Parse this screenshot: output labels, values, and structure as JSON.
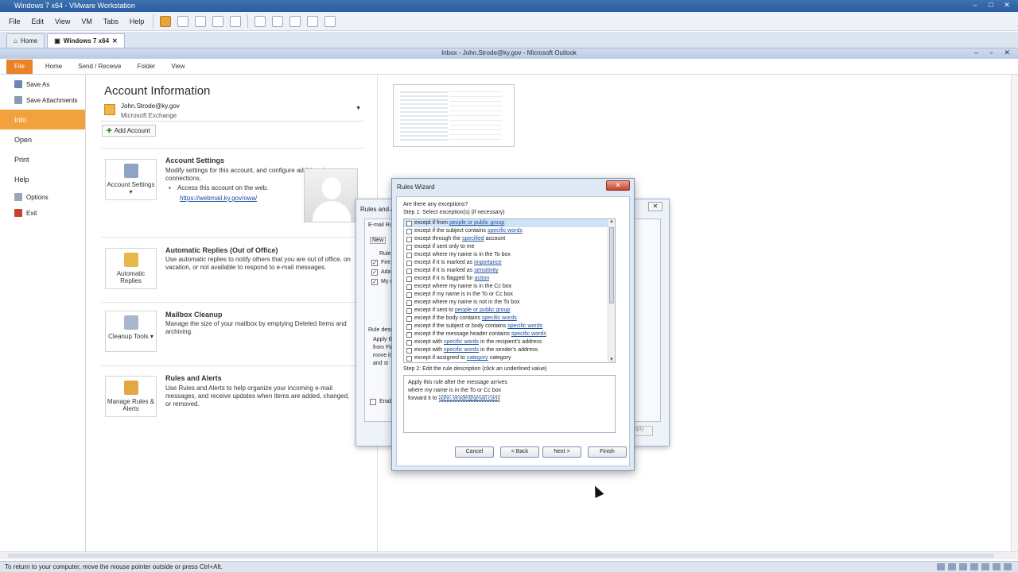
{
  "vm": {
    "title": "Windows 7 x64 - VMware Workstation",
    "menu": [
      "File",
      "Edit",
      "View",
      "VM",
      "Tabs",
      "Help"
    ],
    "tabs": [
      {
        "label": "Home"
      },
      {
        "label": "Windows 7 x64"
      }
    ],
    "status_text": "To return to your computer, move the mouse pointer outside or press Ctrl+Alt."
  },
  "outlook": {
    "title": "Inbox - John.Strode@ky.gov - Microsoft Outlook",
    "ribbon_tabs": [
      "File",
      "Home",
      "Send / Receive",
      "Folder",
      "View"
    ]
  },
  "nav": {
    "items": [
      {
        "label": "Save As",
        "icon": "save-as-icon"
      },
      {
        "label": "Save Attachments",
        "icon": "attachment-icon"
      },
      {
        "label": "Info"
      },
      {
        "label": "Open"
      },
      {
        "label": "Print"
      },
      {
        "label": "Help"
      },
      {
        "label": "Options",
        "icon": "options-icon"
      },
      {
        "label": "Exit",
        "icon": "exit-icon"
      }
    ]
  },
  "account": {
    "heading": "Account Information",
    "email": "John.Strode@ky.gov",
    "type": "Microsoft Exchange",
    "add_button": "Add Account"
  },
  "sections": {
    "settings": {
      "tile": "Account Settings",
      "heading": "Account Settings",
      "text": "Modify settings for this account, and configure additional connections.",
      "bullet": "Access this account on the web.",
      "link": "https://webmail.ky.gov/owa/"
    },
    "auto_replies": {
      "tile": "Automatic Replies",
      "heading": "Automatic Replies (Out of Office)",
      "text": "Use automatic replies to notify others that you are out of office, on vacation, or not available to respond to e-mail messages."
    },
    "cleanup": {
      "tile": "Cleanup Tools",
      "heading": "Mailbox Cleanup",
      "text": "Manage the size of your mailbox by emptying Deleted Items and archiving."
    },
    "rules": {
      "tile": "Manage Rules & Alerts",
      "heading": "Rules and Alerts",
      "text": "Use Rules and Alerts to help organize your incoming e-mail messages, and receive updates when items are added, changed, or removed."
    }
  },
  "rules_alerts": {
    "title": "Rules and A",
    "tab": "E-mail Rul",
    "new": "New",
    "col": "Rule",
    "rows": [
      "Fire",
      "Adam",
      "My n"
    ],
    "rule_desc_label": "Rule desc",
    "desc_lines": [
      "Apply th",
      "from Fir",
      "move it",
      "and st"
    ],
    "enable": "Enabl",
    "apply": "Apply"
  },
  "wizard": {
    "title": "Rules Wizard",
    "question": "Are there any exceptions?",
    "step1": "Step 1: Select exception(s) (if necessary)",
    "exceptions": [
      {
        "a": "except if from",
        "l": "people or public group",
        "b": ""
      },
      {
        "a": "except if the subject contains",
        "l": "specific words",
        "b": ""
      },
      {
        "a": "except through the",
        "l": "specified",
        "b": "account"
      },
      {
        "a": "except if sent only to me",
        "l": "",
        "b": ""
      },
      {
        "a": "except where my name is in the To box",
        "l": "",
        "b": ""
      },
      {
        "a": "except if it is marked as",
        "l": "importance",
        "b": ""
      },
      {
        "a": "except if it is marked as",
        "l": "sensitivity",
        "b": ""
      },
      {
        "a": "except if it is flagged for",
        "l": "action",
        "b": ""
      },
      {
        "a": "except where my name is in the Cc box",
        "l": "",
        "b": ""
      },
      {
        "a": "except if my name is in the To or Cc box",
        "l": "",
        "b": ""
      },
      {
        "a": "except where my name is not in the To box",
        "l": "",
        "b": ""
      },
      {
        "a": "except if sent to",
        "l": "people or public group",
        "b": ""
      },
      {
        "a": "except if the body contains",
        "l": "specific words",
        "b": ""
      },
      {
        "a": "except if the subject or body contains",
        "l": "specific words",
        "b": ""
      },
      {
        "a": "except if the message header contains",
        "l": "specific words",
        "b": ""
      },
      {
        "a": "except with",
        "l": "specific words",
        "b": "in the recipient's address"
      },
      {
        "a": "except with",
        "l": "specific words",
        "b": "in the sender's address"
      },
      {
        "a": "except if assigned to",
        "l": "category",
        "b": "category"
      }
    ],
    "step2": "Step 2: Edit the rule description (click an underlined value)",
    "desc": {
      "line1": "Apply this rule after the message arrives",
      "line2": "where my name is in the To or Cc box",
      "line3": "forward it to",
      "link": "john.strode@gmail.com"
    },
    "buttons": {
      "cancel": "Cancel",
      "back": "< Back",
      "next": "Next >",
      "finish": "Finish"
    }
  }
}
